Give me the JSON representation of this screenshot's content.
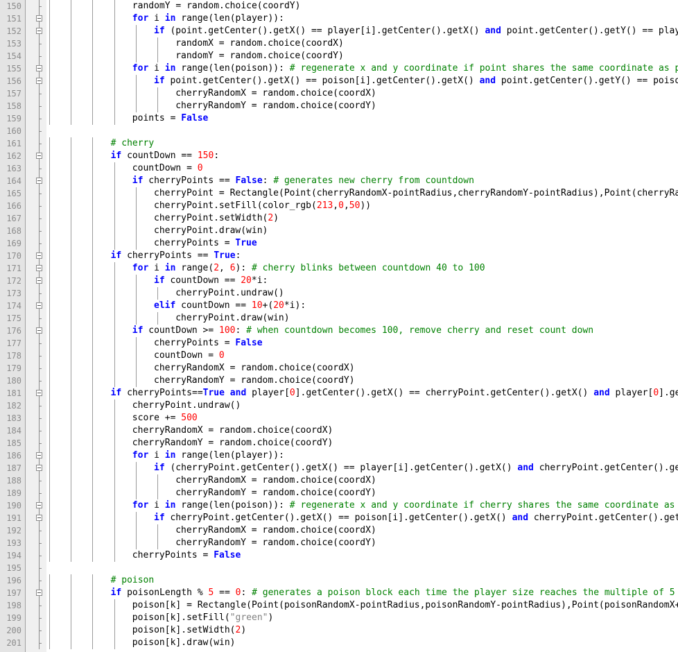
{
  "editor": {
    "language": "python",
    "colors": {
      "keyword": "#0000ff",
      "number": "#ff0000",
      "string": "#808080",
      "comment": "#008000",
      "gutter": "#e4e4e4",
      "line_number": "#8b8b8b"
    },
    "lines": [
      {
        "n": "150",
        "indent": 4,
        "code": [
          [
            "t",
            "randomY = random.choice(coordY)"
          ]
        ]
      },
      {
        "n": "151",
        "indent": 4,
        "fold": 1,
        "code": [
          [
            "k",
            "for"
          ],
          [
            "t",
            " i "
          ],
          [
            "k",
            "in"
          ],
          [
            "t",
            " range(len(player)):"
          ]
        ]
      },
      {
        "n": "152",
        "indent": 5,
        "fold": 1,
        "code": [
          [
            "k",
            "if"
          ],
          [
            "t",
            " (point.getCenter().getX() == player[i].getCenter().getX() "
          ],
          [
            "k",
            "and"
          ],
          [
            "t",
            " point.getCenter().getY() == player[i].getCenter().getY()):"
          ]
        ]
      },
      {
        "n": "153",
        "indent": 6,
        "code": [
          [
            "t",
            "randomX = random.choice(coordX)"
          ]
        ]
      },
      {
        "n": "154",
        "indent": 6,
        "code": [
          [
            "t",
            "randomY = random.choice(coordY)"
          ]
        ]
      },
      {
        "n": "155",
        "indent": 4,
        "fold": 1,
        "code": [
          [
            "k",
            "for"
          ],
          [
            "t",
            " i "
          ],
          [
            "k",
            "in"
          ],
          [
            "t",
            " range(len(poison)): "
          ],
          [
            "c",
            "# regenerate x and y coordinate if point shares the same coordinate as poison"
          ]
        ]
      },
      {
        "n": "156",
        "indent": 5,
        "fold": 1,
        "code": [
          [
            "k",
            "if"
          ],
          [
            "t",
            " point.getCenter().getX() == poison[i].getCenter().getX() "
          ],
          [
            "k",
            "and"
          ],
          [
            "t",
            " point.getCenter().getY() == poison[i].getCenter().getY():"
          ]
        ]
      },
      {
        "n": "157",
        "indent": 6,
        "code": [
          [
            "t",
            "cherryRandomX = random.choice(coordX)"
          ]
        ]
      },
      {
        "n": "158",
        "indent": 6,
        "code": [
          [
            "t",
            "cherryRandomY = random.choice(coordY)"
          ]
        ]
      },
      {
        "n": "159",
        "indent": 4,
        "code": [
          [
            "t",
            "points = "
          ],
          [
            "k",
            "False"
          ]
        ]
      },
      {
        "n": "160",
        "indent": 0,
        "code": []
      },
      {
        "n": "161",
        "indent": 3,
        "code": [
          [
            "c",
            "# cherry"
          ]
        ]
      },
      {
        "n": "162",
        "indent": 3,
        "fold": 1,
        "code": [
          [
            "k",
            "if"
          ],
          [
            "t",
            " countDown == "
          ],
          [
            "n",
            "150"
          ],
          [
            "t",
            ":"
          ]
        ]
      },
      {
        "n": "163",
        "indent": 4,
        "code": [
          [
            "t",
            "countDown = "
          ],
          [
            "n",
            "0"
          ]
        ]
      },
      {
        "n": "164",
        "indent": 4,
        "fold": 1,
        "code": [
          [
            "k",
            "if"
          ],
          [
            "t",
            " cherryPoints == "
          ],
          [
            "k",
            "False"
          ],
          [
            "t",
            ": "
          ],
          [
            "c",
            "# generates new cherry from countdown"
          ]
        ]
      },
      {
        "n": "165",
        "indent": 5,
        "code": [
          [
            "t",
            "cherryPoint = Rectangle(Point(cherryRandomX-pointRadius,cherryRandomY-pointRadius),Point(cherryRandomX+pointRadius,cherryRandomY+pointRadius))"
          ]
        ]
      },
      {
        "n": "166",
        "indent": 5,
        "code": [
          [
            "t",
            "cherryPoint.setFill(color_rgb("
          ],
          [
            "n",
            "213"
          ],
          [
            "t",
            ","
          ],
          [
            "n",
            "0"
          ],
          [
            "t",
            ","
          ],
          [
            "n",
            "50"
          ],
          [
            "t",
            "))"
          ]
        ]
      },
      {
        "n": "167",
        "indent": 5,
        "code": [
          [
            "t",
            "cherryPoint.setWidth("
          ],
          [
            "n",
            "2"
          ],
          [
            "t",
            ")"
          ]
        ]
      },
      {
        "n": "168",
        "indent": 5,
        "code": [
          [
            "t",
            "cherryPoint.draw(win)"
          ]
        ]
      },
      {
        "n": "169",
        "indent": 5,
        "code": [
          [
            "t",
            "cherryPoints = "
          ],
          [
            "k",
            "True"
          ]
        ]
      },
      {
        "n": "170",
        "indent": 3,
        "fold": 1,
        "code": [
          [
            "k",
            "if"
          ],
          [
            "t",
            " cherryPoints == "
          ],
          [
            "k",
            "True"
          ],
          [
            "t",
            ":"
          ]
        ]
      },
      {
        "n": "171",
        "indent": 4,
        "fold": 1,
        "code": [
          [
            "k",
            "for"
          ],
          [
            "t",
            " i "
          ],
          [
            "k",
            "in"
          ],
          [
            "t",
            " range("
          ],
          [
            "n",
            "2"
          ],
          [
            "t",
            ", "
          ],
          [
            "n",
            "6"
          ],
          [
            "t",
            "): "
          ],
          [
            "c",
            "# cherry blinks between countdown 40 to 100"
          ]
        ]
      },
      {
        "n": "172",
        "indent": 5,
        "fold": 1,
        "code": [
          [
            "k",
            "if"
          ],
          [
            "t",
            " countDown == "
          ],
          [
            "n",
            "20"
          ],
          [
            "t",
            "*i:"
          ]
        ]
      },
      {
        "n": "173",
        "indent": 6,
        "code": [
          [
            "t",
            "cherryPoint.undraw()"
          ]
        ]
      },
      {
        "n": "174",
        "indent": 5,
        "fold": 1,
        "code": [
          [
            "k",
            "elif"
          ],
          [
            "t",
            " countDown == "
          ],
          [
            "n",
            "10"
          ],
          [
            "t",
            "+("
          ],
          [
            "n",
            "20"
          ],
          [
            "t",
            "*i):"
          ]
        ]
      },
      {
        "n": "175",
        "indent": 6,
        "code": [
          [
            "t",
            "cherryPoint.draw(win)"
          ]
        ]
      },
      {
        "n": "176",
        "indent": 4,
        "fold": 1,
        "code": [
          [
            "k",
            "if"
          ],
          [
            "t",
            " countDown >= "
          ],
          [
            "n",
            "100"
          ],
          [
            "t",
            ": "
          ],
          [
            "c",
            "# when countdown becomes 100, remove cherry and reset count down"
          ]
        ]
      },
      {
        "n": "177",
        "indent": 5,
        "code": [
          [
            "t",
            "cherryPoints = "
          ],
          [
            "k",
            "False"
          ]
        ]
      },
      {
        "n": "178",
        "indent": 5,
        "code": [
          [
            "t",
            "countDown = "
          ],
          [
            "n",
            "0"
          ]
        ]
      },
      {
        "n": "179",
        "indent": 5,
        "code": [
          [
            "t",
            "cherryRandomX = random.choice(coordX)"
          ]
        ]
      },
      {
        "n": "180",
        "indent": 5,
        "code": [
          [
            "t",
            "cherryRandomY = random.choice(coordY)"
          ]
        ]
      },
      {
        "n": "181",
        "indent": 3,
        "fold": 1,
        "code": [
          [
            "k",
            "if"
          ],
          [
            "t",
            " cherryPoints=="
          ],
          [
            "k",
            "True"
          ],
          [
            "t",
            " "
          ],
          [
            "k",
            "and"
          ],
          [
            "t",
            " player["
          ],
          [
            "n",
            "0"
          ],
          [
            "t",
            "].getCenter().getX() == cherryPoint.getCenter().getX() "
          ],
          [
            "k",
            "and"
          ],
          [
            "t",
            " player["
          ],
          [
            "n",
            "0"
          ],
          [
            "t",
            "].getCenter().getY() == cherryPoint.getCenter().getY():"
          ]
        ]
      },
      {
        "n": "182",
        "indent": 4,
        "code": [
          [
            "t",
            "cherryPoint.undraw()"
          ]
        ]
      },
      {
        "n": "183",
        "indent": 4,
        "code": [
          [
            "t",
            "score += "
          ],
          [
            "n",
            "500"
          ]
        ]
      },
      {
        "n": "184",
        "indent": 4,
        "code": [
          [
            "t",
            "cherryRandomX = random.choice(coordX)"
          ]
        ]
      },
      {
        "n": "185",
        "indent": 4,
        "code": [
          [
            "t",
            "cherryRandomY = random.choice(coordY)"
          ]
        ]
      },
      {
        "n": "186",
        "indent": 4,
        "fold": 1,
        "code": [
          [
            "k",
            "for"
          ],
          [
            "t",
            " i "
          ],
          [
            "k",
            "in"
          ],
          [
            "t",
            " range(len(player)):"
          ]
        ]
      },
      {
        "n": "187",
        "indent": 5,
        "fold": 1,
        "code": [
          [
            "k",
            "if"
          ],
          [
            "t",
            " (cherryPoint.getCenter().getX() == player[i].getCenter().getX() "
          ],
          [
            "k",
            "and"
          ],
          [
            "t",
            " cherryPoint.getCenter().getY() == player[i].getCenter().getY()):"
          ]
        ]
      },
      {
        "n": "188",
        "indent": 6,
        "code": [
          [
            "t",
            "cherryRandomX = random.choice(coordX)"
          ]
        ]
      },
      {
        "n": "189",
        "indent": 6,
        "code": [
          [
            "t",
            "cherryRandomY = random.choice(coordY)"
          ]
        ]
      },
      {
        "n": "190",
        "indent": 4,
        "fold": 1,
        "code": [
          [
            "k",
            "for"
          ],
          [
            "t",
            " i "
          ],
          [
            "k",
            "in"
          ],
          [
            "t",
            " range(len(poison)): "
          ],
          [
            "c",
            "# regenerate x and y coordinate if cherry shares the same coordinate as poison"
          ]
        ]
      },
      {
        "n": "191",
        "indent": 5,
        "fold": 1,
        "code": [
          [
            "k",
            "if"
          ],
          [
            "t",
            " cherryPoint.getCenter().getX() == poison[i].getCenter().getX() "
          ],
          [
            "k",
            "and"
          ],
          [
            "t",
            " cherryPoint.getCenter().getY() == poison[i].getCenter().getY():"
          ]
        ]
      },
      {
        "n": "192",
        "indent": 6,
        "code": [
          [
            "t",
            "cherryRandomX = random.choice(coordX)"
          ]
        ]
      },
      {
        "n": "193",
        "indent": 6,
        "code": [
          [
            "t",
            "cherryRandomY = random.choice(coordY)"
          ]
        ]
      },
      {
        "n": "194",
        "indent": 4,
        "code": [
          [
            "t",
            "cherryPoints = "
          ],
          [
            "k",
            "False"
          ]
        ]
      },
      {
        "n": "195",
        "indent": 0,
        "code": []
      },
      {
        "n": "196",
        "indent": 3,
        "code": [
          [
            "c",
            "# poison"
          ]
        ]
      },
      {
        "n": "197",
        "indent": 3,
        "fold": 1,
        "code": [
          [
            "k",
            "if"
          ],
          [
            "t",
            " poisonLength % "
          ],
          [
            "n",
            "5"
          ],
          [
            "t",
            " == "
          ],
          [
            "n",
            "0"
          ],
          [
            "t",
            ": "
          ],
          [
            "c",
            "# generates a poison block each time the player size reaches the multiple of 5"
          ]
        ]
      },
      {
        "n": "198",
        "indent": 4,
        "code": [
          [
            "t",
            "poison[k] = Rectangle(Point(poisonRandomX-pointRadius,poisonRandomY-pointRadius),Point(poisonRandomX+pointRadius,poisonRandomY+pointRadius))"
          ]
        ]
      },
      {
        "n": "199",
        "indent": 4,
        "code": [
          [
            "t",
            "poison[k].setFill("
          ],
          [
            "s",
            "\"green\""
          ],
          [
            "t",
            ")"
          ]
        ]
      },
      {
        "n": "200",
        "indent": 4,
        "code": [
          [
            "t",
            "poison[k].setWidth("
          ],
          [
            "n",
            "2"
          ],
          [
            "t",
            ")"
          ]
        ]
      },
      {
        "n": "201",
        "indent": 4,
        "code": [
          [
            "t",
            "poison[k].draw(win)"
          ]
        ]
      }
    ]
  }
}
